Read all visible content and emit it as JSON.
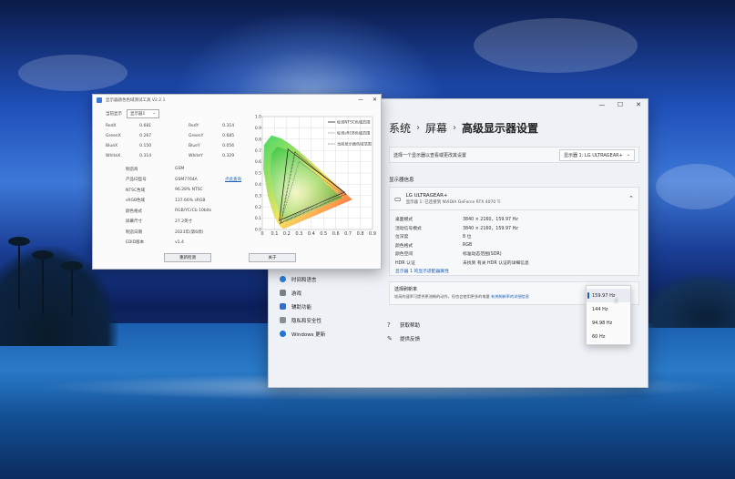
{
  "settings": {
    "breadcrumb": [
      "系统",
      "屏幕",
      "高级显示器设置"
    ],
    "select_label": "选择一个显示器以查看或更改其设置",
    "select_value": "显示器 1: LG ULTRAGEAR+",
    "section_title": "显示器信息",
    "monitor_name": "LG ULTRAGEAR+",
    "monitor_sub": "显示器 1: 已连接到 NVIDIA GeForce RTX 4070 Ti",
    "info": [
      {
        "label": "桌面模式",
        "value": "3840 × 2160，159.97 Hz"
      },
      {
        "label": "活动信号模式",
        "value": "3840 × 2160，159.97 Hz"
      },
      {
        "label": "位深度",
        "value": "8 位"
      },
      {
        "label": "颜色格式",
        "value": "RGB"
      },
      {
        "label": "颜色空间",
        "value": "标准动态范围(SDR)"
      },
      {
        "label": "HDR 认证",
        "value": "未找到 有关 HDR 认证的详细信息"
      }
    ],
    "adapter_link": "显示器 1 的显示适配器属性",
    "refresh_title": "选择刷新率",
    "refresh_desc": "较高的速率可提供更流畅的动作，但也会使用更多的电量",
    "refresh_link": "有关刷新率的详细信息",
    "nav": [
      "时间和语言",
      "游戏",
      "辅助功能",
      "隐私和安全性",
      "Windows 更新"
    ],
    "help": [
      "获取帮助",
      "提供反馈"
    ],
    "refresh_options": [
      "159.97 Hz",
      "144 Hz",
      "94.98 Hz",
      "60 Hz"
    ],
    "selected_refresh": "159.97 Hz"
  },
  "tool": {
    "title": "显示器颜色色域测试工具 V2.2.1",
    "display_label": "当前显示",
    "display_value": "显示器1",
    "coords": [
      {
        "a_label": "RedX",
        "a_val": "0.681",
        "b_label": "RedY",
        "b_val": "0.314"
      },
      {
        "a_label": "GreenX",
        "a_val": "0.267",
        "b_label": "GreenY",
        "b_val": "0.685"
      },
      {
        "a_label": "BlueX",
        "a_val": "0.150",
        "b_label": "BlueY",
        "b_val": "0.056"
      },
      {
        "a_label": "WhiteX",
        "a_val": "0.314",
        "b_label": "WhiteY",
        "b_val": "0.329"
      }
    ],
    "specs": [
      {
        "label": "制造商",
        "value": "GSM"
      },
      {
        "label": "产品ID型号",
        "value": "GSM7764A",
        "link": "点此查询"
      },
      {
        "label": "NTSC色域",
        "value": "96.28% NTSC"
      },
      {
        "label": "sRGB色域",
        "value": "137.66% sRGB"
      },
      {
        "label": "颜色格式",
        "value": "RGB/YCrCb 10bits"
      },
      {
        "label": "屏幕尺寸",
        "value": "27.2英寸"
      },
      {
        "label": "制造日期",
        "value": "2023年(第6周)"
      },
      {
        "label": "EDID版本",
        "value": "v1.4"
      }
    ],
    "btn_refresh": "重新检测",
    "btn_about": "关于"
  },
  "chart_data": {
    "type": "scatter",
    "title": "",
    "xlabel": "",
    "ylabel": "",
    "xlim": [
      0,
      0.9
    ],
    "ylim": [
      0,
      1.0
    ],
    "x_ticks": [
      "0",
      "0.1",
      "0.2",
      "0.3",
      "0.4",
      "0.5",
      "0.6",
      "0.7",
      "0.8",
      "0.9"
    ],
    "y_ticks": [
      "1.0",
      "0.9",
      "0.8",
      "0.7",
      "0.6",
      "0.5",
      "0.4",
      "0.3",
      "0.2",
      "0.1",
      "0.0"
    ],
    "legend": [
      "标准NTSC色域范围",
      "标准sRGB色域范围",
      "当前显示器色域范围"
    ],
    "series": [
      {
        "name": "标准NTSC色域范围",
        "points": [
          [
            0.67,
            0.33
          ],
          [
            0.21,
            0.71
          ],
          [
            0.14,
            0.08
          ]
        ]
      },
      {
        "name": "标准sRGB色域范围",
        "points": [
          [
            0.64,
            0.33
          ],
          [
            0.3,
            0.6
          ],
          [
            0.15,
            0.06
          ]
        ]
      },
      {
        "name": "当前显示器色域范围",
        "points": [
          [
            0.681,
            0.314
          ],
          [
            0.267,
            0.685
          ],
          [
            0.15,
            0.056
          ]
        ]
      }
    ],
    "colors": {
      "ntsc": "#222222",
      "srgb": "#888888",
      "current": "#333333"
    }
  }
}
